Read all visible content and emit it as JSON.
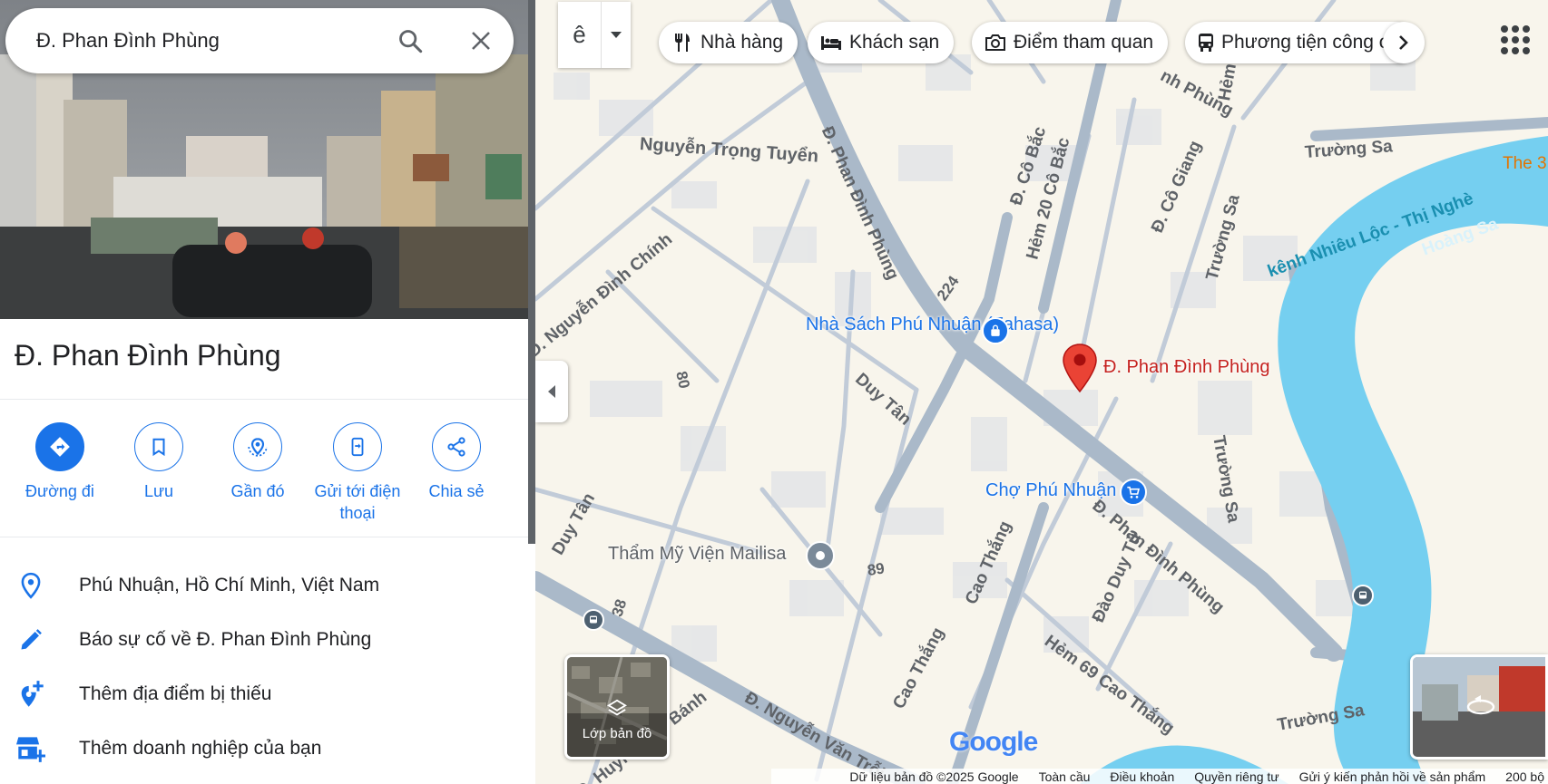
{
  "search": {
    "value": "Đ. Phan Đình Phùng"
  },
  "place": {
    "title": "Đ. Phan Đình Phùng"
  },
  "actions": [
    {
      "label": "Đường đi"
    },
    {
      "label": "Lưu"
    },
    {
      "label": "Gần đó"
    },
    {
      "label": "Gửi tới điện thoại"
    },
    {
      "label": "Chia sẻ"
    }
  ],
  "info": [
    {
      "icon": "location-pin-icon",
      "text": "Phú Nhuận, Hồ Chí Minh, Việt Nam"
    },
    {
      "icon": "pencil-icon",
      "text": "Báo sự cố về Đ. Phan Đình Phùng"
    },
    {
      "icon": "add-place-icon",
      "text": "Thêm địa điểm bị thiếu"
    },
    {
      "icon": "add-business-icon",
      "text": "Thêm doanh nghiệp của bạn"
    }
  ],
  "map_controls": {
    "lang_glyph": "ê"
  },
  "categories": [
    {
      "icon": "restaurant-icon",
      "label": "Nhà hàng"
    },
    {
      "icon": "hotel-icon",
      "label": "Khách sạn"
    },
    {
      "icon": "camera-icon",
      "label": "Điểm tham quan"
    },
    {
      "icon": "transit-icon",
      "label": "Phương tiện công c"
    }
  ],
  "map_labels": {
    "nguyen_trong_tuyen": "Nguyễn Trọng Tuyển",
    "phan_dinh_phung_1": "Đ. Phan Đình Phùng",
    "phan_dinh_phung_2": "Đ. Phan Đình Phùng",
    "phan_top": "nh Phùng",
    "nguyen_dinh_chinh": "Đ. Nguyễn Đình Chính",
    "duy_tan_1": "Duy Tân",
    "duy_tan_2": "Duy Tân",
    "co_bac": "Đ. Cô Bắc",
    "hem_20": "Hẻm 20 Cô Bắc",
    "co_giang": "Đ. Cô Giang",
    "truong_sa_1": "Trường Sa",
    "truong_sa_2": "Trường Sa",
    "truong_sa_3": "Trường Sa",
    "truong_sa_4": "Trường Sa",
    "kenh": "kênh Nhiêu Lộc - Thị Nghè",
    "hoang_sa": "Hoàng Sa",
    "cao_thang_1": "Cao Thắng",
    "cao_thang_2": "Cao Thắng",
    "hem_69": "Hẻm 69 Cao Thắng",
    "dao_duy_tu": "Đào Duy Từ",
    "nguyen_van_troi": "Đ. Nguyễn Văn Trỗi",
    "huynh_van_banh": "Đ. Huỳnh Văn Bánh",
    "hem": "Hẻm",
    "num_224": "224",
    "num_80": "80",
    "num_89": "89",
    "num_38": "38",
    "the3": "The 3"
  },
  "pois": {
    "fahasa": "Nhà Sách Phú Nhuận (Fahasa)",
    "cho": "Chợ Phú Nhuận",
    "mailisa": "Thẩm Mỹ Viện Mailisa",
    "pin": "Đ. Phan Đình Phùng"
  },
  "layer_button": {
    "label": "Lớp bản đồ"
  },
  "footer": {
    "copyright": "Dữ liệu bản đồ ©2025 Google",
    "global": "Toàn cầu",
    "terms": "Điều khoản",
    "privacy": "Quyền riêng tư",
    "feedback": "Gửi ý kiến phản hồi về sản phẩm",
    "scale": "200 bộ"
  },
  "google_logo": "Google",
  "colors": {
    "accent": "#1a73e8",
    "pin": "#ea4335",
    "water": "#75cff0",
    "road": "#aab9c9",
    "land": "#f8f5ec"
  }
}
